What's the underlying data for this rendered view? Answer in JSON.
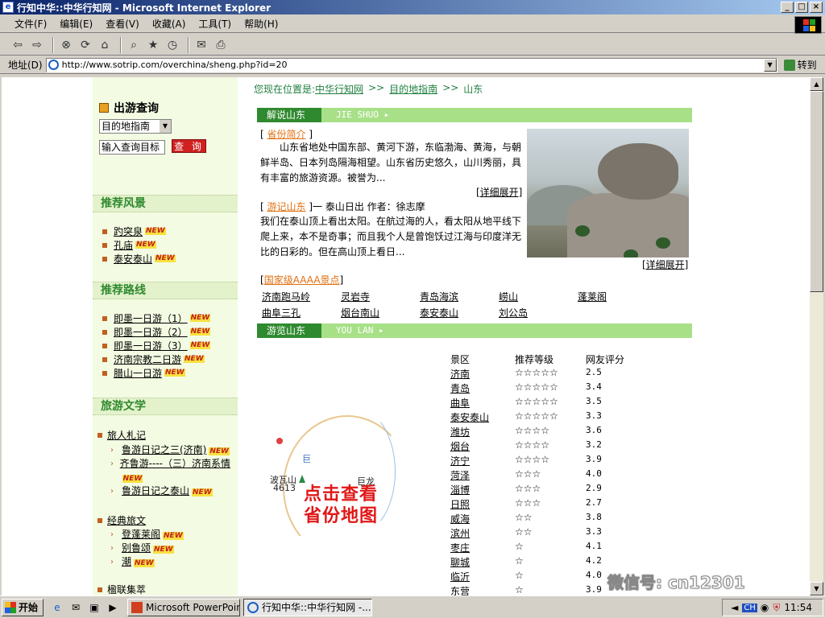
{
  "window": {
    "title": "行知中华::中华行知网 - Microsoft Internet Explorer"
  },
  "menu": [
    "文件(F)",
    "编辑(E)",
    "查看(V)",
    "收藏(A)",
    "工具(T)",
    "帮助(H)"
  ],
  "toolbar_icons": [
    "back-icon",
    "forward-icon",
    "stop-icon",
    "refresh-icon",
    "home-icon",
    "search-icon",
    "favorites-icon",
    "history-icon",
    "mail-icon",
    "print-icon"
  ],
  "address": {
    "label": "地址(D)",
    "url": "http://www.sotrip.com/overchina/sheng.php?id=20",
    "go": "转到"
  },
  "sidebar": {
    "search_title": "出游查询",
    "select_value": "目的地指南",
    "input_placeholder": "输入查询目标",
    "search_button": "查 询",
    "sec_scenery": "推荐风景",
    "scenery": [
      "趵突泉",
      "孔庙",
      "泰安泰山"
    ],
    "sec_routes": "推荐路线",
    "routes": [
      "即墨一日游（1）",
      "即墨一日游（2）",
      "即墨一日游（3）",
      "济南宗教二日游",
      "腊山一日游"
    ],
    "sec_literature": "旅游文学",
    "group1": "旅人札记",
    "group1_items": [
      "鲁游日记之三(济南)",
      "齐鲁游----（三）济南系情",
      "鲁游日记之泰山"
    ],
    "group2": "经典旅文",
    "group2_items": [
      "登蓬莱阁",
      "别鲁颂",
      "潮"
    ],
    "group3": "楹联集萃",
    "new_badge": "NEW"
  },
  "main": {
    "crumb_prefix": "您现在位置是:",
    "crumb": [
      "中华行知网",
      "目的地指南",
      "山东"
    ],
    "crumb_sep": ">>",
    "bar1_tag": "解说山东",
    "bar1_en": "JIE SHUO",
    "intro_head": "省份简介",
    "intro_text": "山东省地处中国东部、黄河下游，东临渤海、黄海，与朝鲜半岛、日本列岛隔海相望。山东省历史悠久，山川秀丽，具有丰富的旅游资源。被誉为...",
    "more1": "[详细展开]",
    "travel_head": "游记山东",
    "travel_title": "]一 泰山日出 作者：徐志摩",
    "travel_text": "我们在泰山顶上看出太阳。在航过海的人，看太阳从地平线下爬上来，本不是奇事；而且我个人是曾饱饫过江海与印度洋无比的日彩的。但在高山顶上看日...",
    "more2": "[详细展开]",
    "nat_head": "国家级AAAA景点",
    "spots": [
      "济南跑马岭",
      "灵岩寺",
      "青岛海滨",
      "崂山",
      "蓬莱阁",
      "曲阜三孔",
      "烟台南山",
      "泰安泰山",
      "刘公岛"
    ],
    "bar2_tag": "游览山东",
    "bar2_en": "YOU LAN",
    "map_cta": [
      "点击查看",
      "省份地图"
    ],
    "map_labels": [
      "波瓦山",
      "4613",
      "巨龙",
      "巨"
    ],
    "table_headers": [
      "景区",
      "推荐等级",
      "网友评分"
    ],
    "table_rows": [
      {
        "name": "济南",
        "stars": "☆☆☆☆☆",
        "score": "2.5"
      },
      {
        "name": "青岛",
        "stars": "☆☆☆☆☆",
        "score": "3.4"
      },
      {
        "name": "曲阜",
        "stars": "☆☆☆☆☆",
        "score": "3.5"
      },
      {
        "name": "泰安泰山",
        "stars": "☆☆☆☆☆",
        "score": "3.3"
      },
      {
        "name": "潍坊",
        "stars": "☆☆☆☆",
        "score": "3.6"
      },
      {
        "name": "烟台",
        "stars": "☆☆☆☆",
        "score": "3.2"
      },
      {
        "name": "济宁",
        "stars": "☆☆☆☆",
        "score": "3.9"
      },
      {
        "name": "菏泽",
        "stars": "☆☆☆",
        "score": "4.0"
      },
      {
        "name": "淄博",
        "stars": "☆☆☆",
        "score": "2.9"
      },
      {
        "name": "日照",
        "stars": "☆☆☆",
        "score": "2.7"
      },
      {
        "name": "威海",
        "stars": "☆☆",
        "score": "3.8"
      },
      {
        "name": "滨州",
        "stars": "☆☆",
        "score": "3.3"
      },
      {
        "name": "枣庄",
        "stars": "☆",
        "score": "4.1"
      },
      {
        "name": "聊城",
        "stars": "☆",
        "score": "4.2"
      },
      {
        "name": "临沂",
        "stars": "☆",
        "score": "4.0"
      },
      {
        "name": "东营",
        "stars": "☆",
        "score": "3.9"
      }
    ]
  },
  "watermark": "微信号: cn12301",
  "taskbar": {
    "start": "开始",
    "task1": "Microsoft PowerPoint - [...",
    "task2": "行知中华::中华行知网 -...",
    "time": "11:54",
    "ime": "CH"
  }
}
